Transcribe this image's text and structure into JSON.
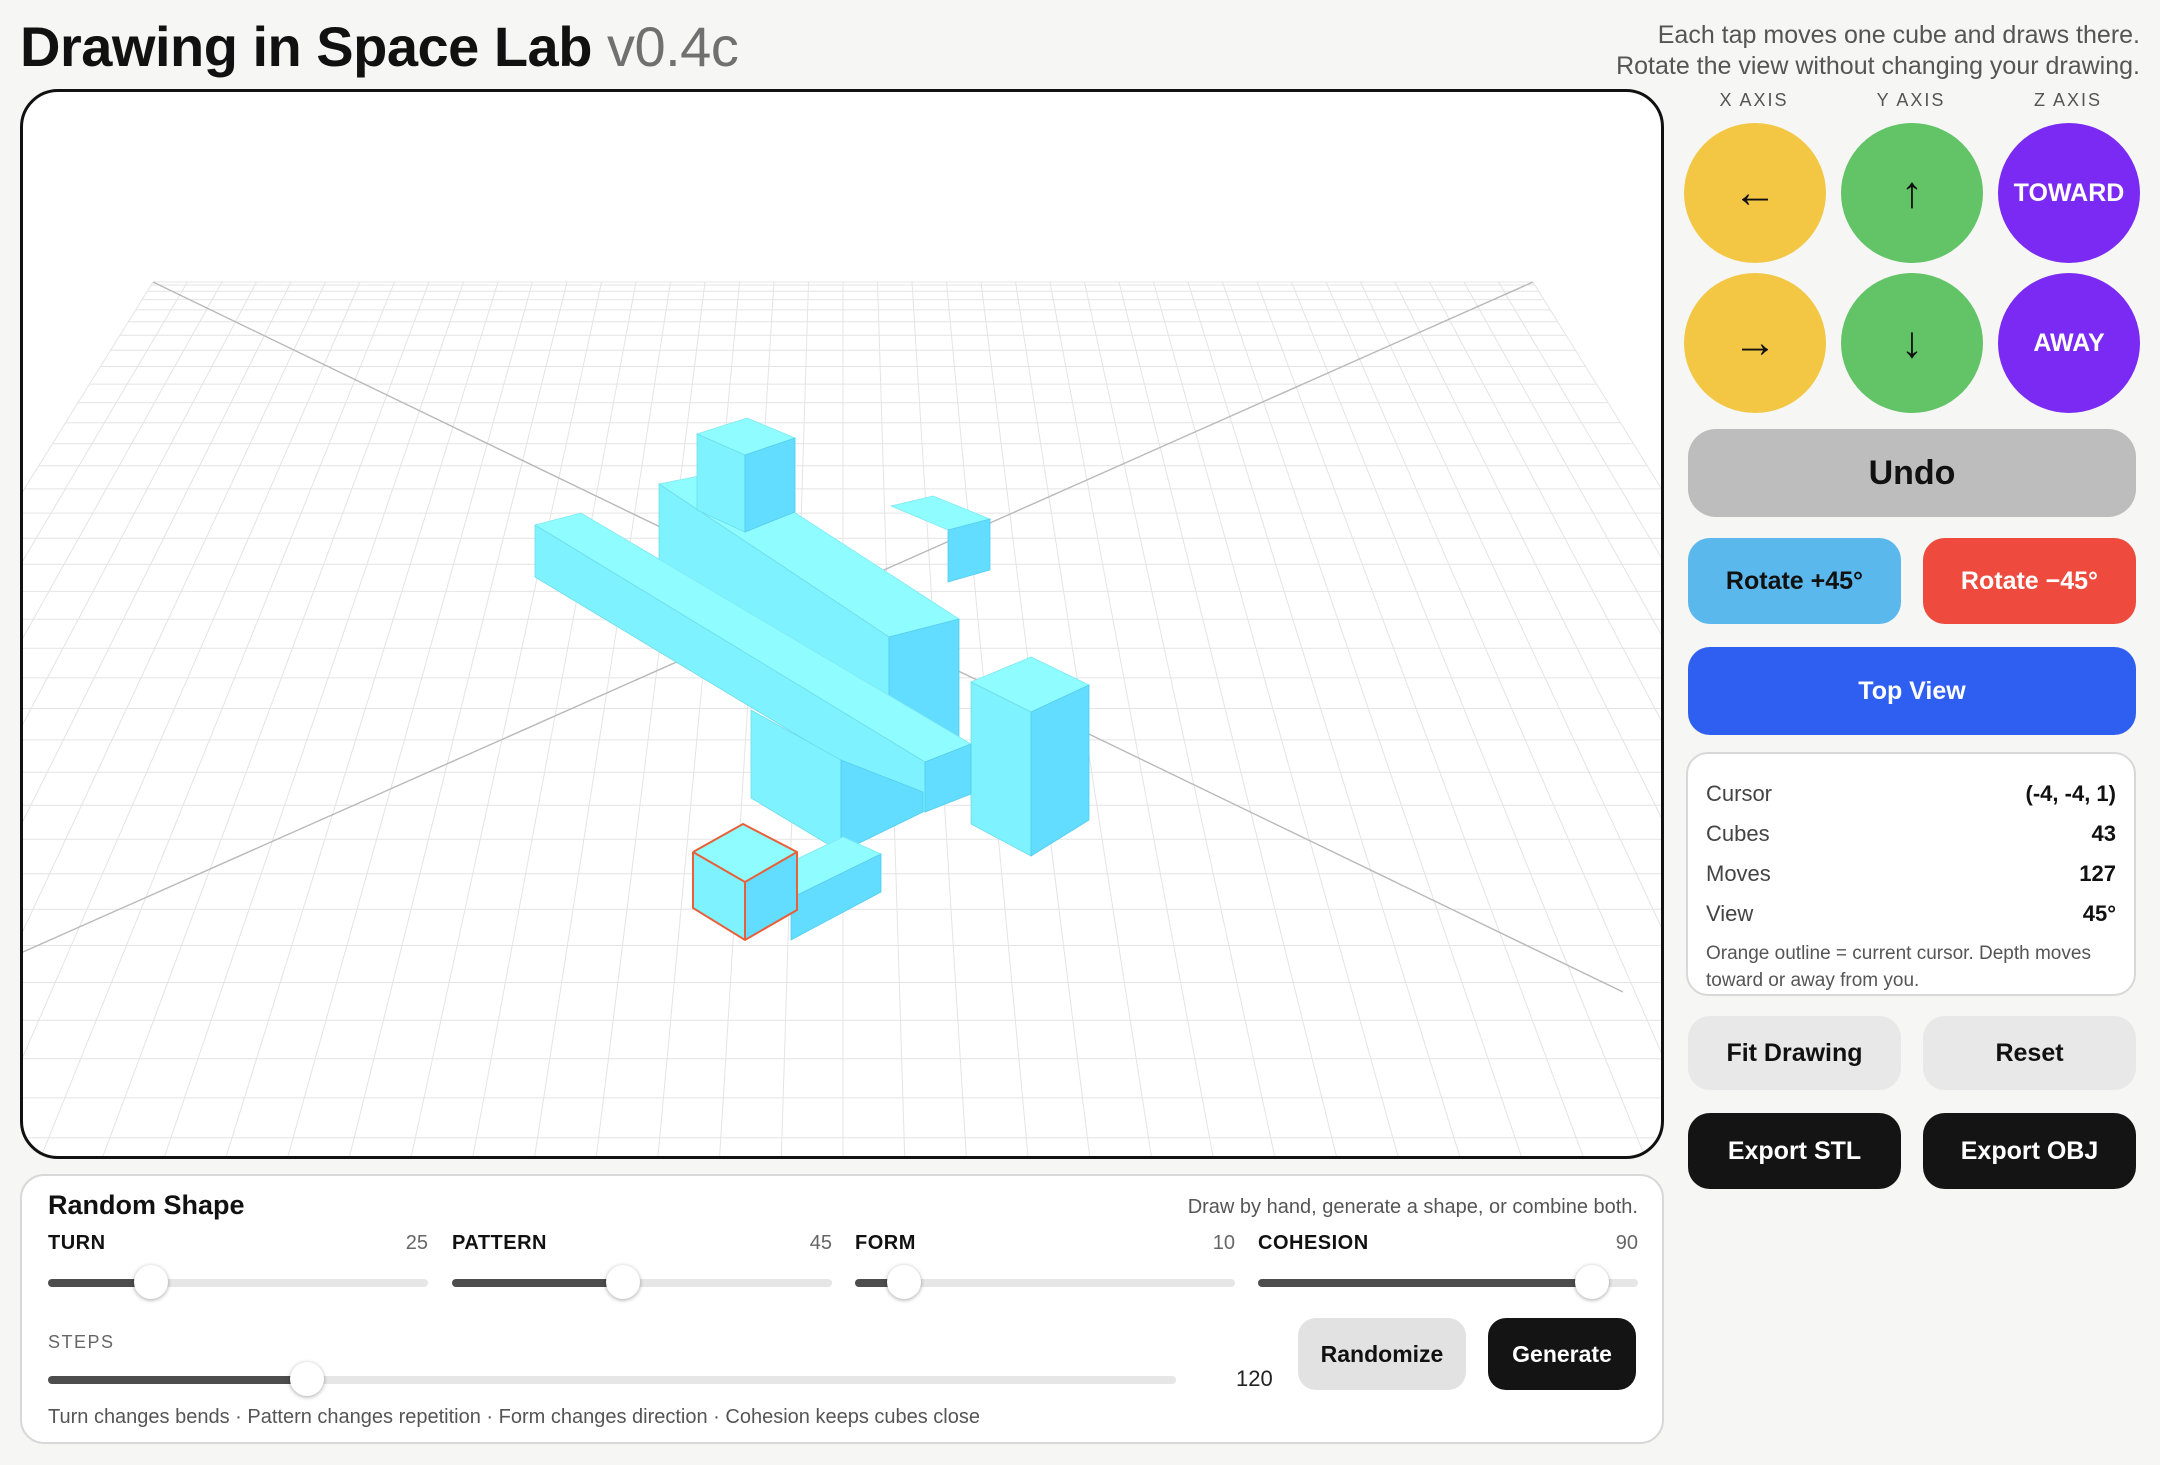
{
  "app": {
    "title": "Drawing in Space Lab",
    "version": "v0.4c",
    "help_line1": "Each tap moves one cube and draws there.",
    "help_line2": "Rotate the view without changing your drawing."
  },
  "axes": {
    "x_label": "X AXIS",
    "y_label": "Y AXIS",
    "z_label": "Z AXIS",
    "x_neg": "←",
    "x_pos": "→",
    "y_pos": "↑",
    "y_neg": "↓",
    "z_toward": "TOWARD",
    "z_away": "AWAY"
  },
  "controls": {
    "undo": "Undo",
    "rotate_plus": "Rotate +45°",
    "rotate_minus": "Rotate −45°",
    "top_view": "Top View",
    "fit_drawing": "Fit Drawing",
    "reset": "Reset",
    "export_stl": "Export STL",
    "export_obj": "Export OBJ"
  },
  "info": {
    "cursor_label": "Cursor",
    "cursor_value": "(-4, -4, 1)",
    "cubes_label": "Cubes",
    "cubes_value": "43",
    "moves_label": "Moves",
    "moves_value": "127",
    "view_label": "View",
    "view_value": "45°",
    "note": "Orange outline = current cursor. Depth moves toward or away from you."
  },
  "random_shape": {
    "title": "Random Shape",
    "description": "Draw by hand, generate a shape, or combine both.",
    "sliders": [
      {
        "name": "TURN",
        "value": "25",
        "fraction": 0.27
      },
      {
        "name": "PATTERN",
        "value": "45",
        "fraction": 0.45
      },
      {
        "name": "FORM",
        "value": "10",
        "fraction": 0.13
      },
      {
        "name": "COHESION",
        "value": "90",
        "fraction": 0.88
      }
    ],
    "steps_label": "STEPS",
    "steps_value": "120",
    "steps_fraction": 0.23,
    "randomize": "Randomize",
    "generate": "Generate",
    "footer": "Turn changes bends · Pattern changes repetition · Form changes direction · Cohesion keeps cubes close"
  },
  "colors": {
    "cube_top": "#8ffcff",
    "cube_left": "#7ef2ff",
    "cube_right": "#62dcff",
    "cursor_outline": "#e8603a",
    "x_axis": "#f3c744",
    "y_axis": "#62c466",
    "z_axis": "#7a2af2"
  }
}
